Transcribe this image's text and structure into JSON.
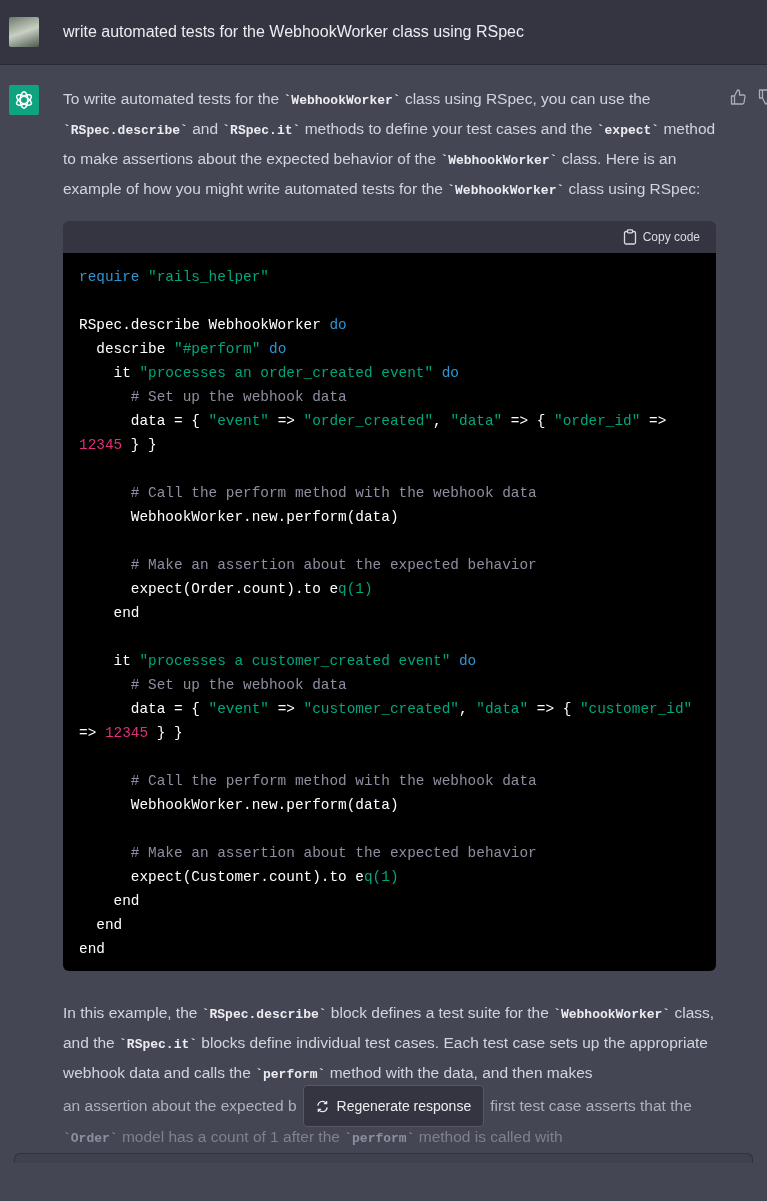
{
  "prompt": {
    "text": "write automated tests for the WebhookWorker class using RSpec"
  },
  "answer": {
    "intro": [
      {
        "kind": "text",
        "text": "To write automated tests for the "
      },
      {
        "kind": "code",
        "text": "`WebhookWorker`"
      },
      {
        "kind": "text",
        "text": " class using RSpec, you can use the "
      },
      {
        "kind": "code",
        "text": "`RSpec.describe`"
      },
      {
        "kind": "text",
        "text": " and "
      },
      {
        "kind": "code",
        "text": "`RSpec.it`"
      },
      {
        "kind": "text",
        "text": " methods to define your test cases and the "
      },
      {
        "kind": "code",
        "text": "`expect`"
      },
      {
        "kind": "text",
        "text": " method to make assertions about the expected behavior of the "
      },
      {
        "kind": "code",
        "text": "`WebhookWorker`"
      },
      {
        "kind": "text",
        "text": " class. Here is an example of how you might write automated tests for the "
      },
      {
        "kind": "code",
        "text": "`WebhookWorker`"
      },
      {
        "kind": "text",
        "text": " class using RSpec:"
      }
    ],
    "code": {
      "copy_label": "Copy code",
      "blocks": [
        [
          [
            {
              "kind": "keyword",
              "text": "require "
            },
            {
              "kind": "string",
              "text": "\"rails_helper\""
            }
          ]
        ],
        [
          [
            {
              "kind": "plain",
              "text": "RSpec.describe WebhookWorker "
            },
            {
              "kind": "keyword",
              "text": "do"
            }
          ],
          [
            {
              "kind": "plain",
              "text": "  describe "
            },
            {
              "kind": "string",
              "text": "\"#perform\" "
            },
            {
              "kind": "keyword",
              "text": "do"
            }
          ],
          [
            {
              "kind": "plain",
              "text": "    it "
            },
            {
              "kind": "string",
              "text": "\"processes an order_created event\" "
            },
            {
              "kind": "keyword",
              "text": "do"
            }
          ],
          [
            {
              "kind": "comment",
              "text": "      # Set up the webhook data"
            }
          ],
          [
            {
              "kind": "plain",
              "text": "      data = { "
            },
            {
              "kind": "string",
              "text": "\"event\""
            },
            {
              "kind": "plain",
              "text": " => "
            },
            {
              "kind": "string",
              "text": "\"order_created\""
            },
            {
              "kind": "plain",
              "text": ", "
            },
            {
              "kind": "string",
              "text": "\"data\""
            },
            {
              "kind": "plain",
              "text": " => { "
            },
            {
              "kind": "string",
              "text": "\"order_id\""
            },
            {
              "kind": "plain",
              "text": " =>"
            }
          ],
          [
            {
              "kind": "number",
              "text": "12345"
            },
            {
              "kind": "plain",
              "text": " } }"
            }
          ]
        ],
        [
          [
            {
              "kind": "comment",
              "text": "      # Call the perform method with the webhook data"
            }
          ],
          [
            {
              "kind": "plain",
              "text": "      WebhookWorker.new.perform(data)"
            }
          ]
        ],
        [
          [
            {
              "kind": "comment",
              "text": "      # Make an assertion about the expected behavior"
            }
          ],
          [
            {
              "kind": "plain",
              "text": "      expect(Order.count).to e"
            },
            {
              "kind": "string",
              "text": "q(1)"
            }
          ],
          [
            {
              "kind": "plain",
              "text": "    end"
            }
          ]
        ],
        [
          [
            {
              "kind": "plain",
              "text": "    it "
            },
            {
              "kind": "string",
              "text": "\"processes a customer_created event\" "
            },
            {
              "kind": "keyword",
              "text": "do"
            }
          ],
          [
            {
              "kind": "comment",
              "text": "      # Set up the webhook data"
            }
          ],
          [
            {
              "kind": "plain",
              "text": "      data = { "
            },
            {
              "kind": "string",
              "text": "\"event\""
            },
            {
              "kind": "plain",
              "text": " => "
            },
            {
              "kind": "string",
              "text": "\"customer_created\""
            },
            {
              "kind": "plain",
              "text": ", "
            },
            {
              "kind": "string",
              "text": "\"data\""
            },
            {
              "kind": "plain",
              "text": " => { "
            },
            {
              "kind": "string",
              "text": "\"customer_id\""
            }
          ],
          [
            {
              "kind": "plain",
              "text": "=> "
            },
            {
              "kind": "number",
              "text": "12345"
            },
            {
              "kind": "plain",
              "text": " } }"
            }
          ]
        ],
        [
          [
            {
              "kind": "comment",
              "text": "      # Call the perform method with the webhook data"
            }
          ],
          [
            {
              "kind": "plain",
              "text": "      WebhookWorker.new.perform(data)"
            }
          ]
        ],
        [
          [
            {
              "kind": "comment",
              "text": "      # Make an assertion about the expected behavior"
            }
          ],
          [
            {
              "kind": "plain",
              "text": "      expect(Customer.count).to e"
            },
            {
              "kind": "string",
              "text": "q(1)"
            }
          ],
          [
            {
              "kind": "plain",
              "text": "    end"
            }
          ],
          [
            {
              "kind": "plain",
              "text": "  end"
            }
          ],
          [
            {
              "kind": "plain",
              "text": "end"
            }
          ]
        ]
      ]
    },
    "explanation": [
      {
        "kind": "text",
        "text": "In this example, the "
      },
      {
        "kind": "code",
        "text": "`RSpec.describe`"
      },
      {
        "kind": "text",
        "text": " block defines a test suite for the "
      },
      {
        "kind": "code",
        "text": "`WebhookWorker`"
      },
      {
        "kind": "text",
        "text": " class, and the "
      },
      {
        "kind": "code",
        "text": "`RSpec.it`"
      },
      {
        "kind": "text",
        "text": " blocks define individual test cases. Each test case sets up the appropriate webhook data and calls the "
      },
      {
        "kind": "code",
        "text": "`perform`"
      },
      {
        "kind": "text",
        "text": " method with the data, and then makes"
      }
    ],
    "covered_line": {
      "before": "an assertion about the expected b",
      "after": "first test case asserts that the"
    },
    "faded_line": [
      {
        "kind": "code",
        "text": "`Order`"
      },
      {
        "kind": "text",
        "text": " model has a count of 1 after the "
      },
      {
        "kind": "code",
        "text": "`perform`"
      },
      {
        "kind": "text",
        "text": " method is called with"
      }
    ]
  },
  "regenerate_button": {
    "label": "Regenerate response"
  }
}
